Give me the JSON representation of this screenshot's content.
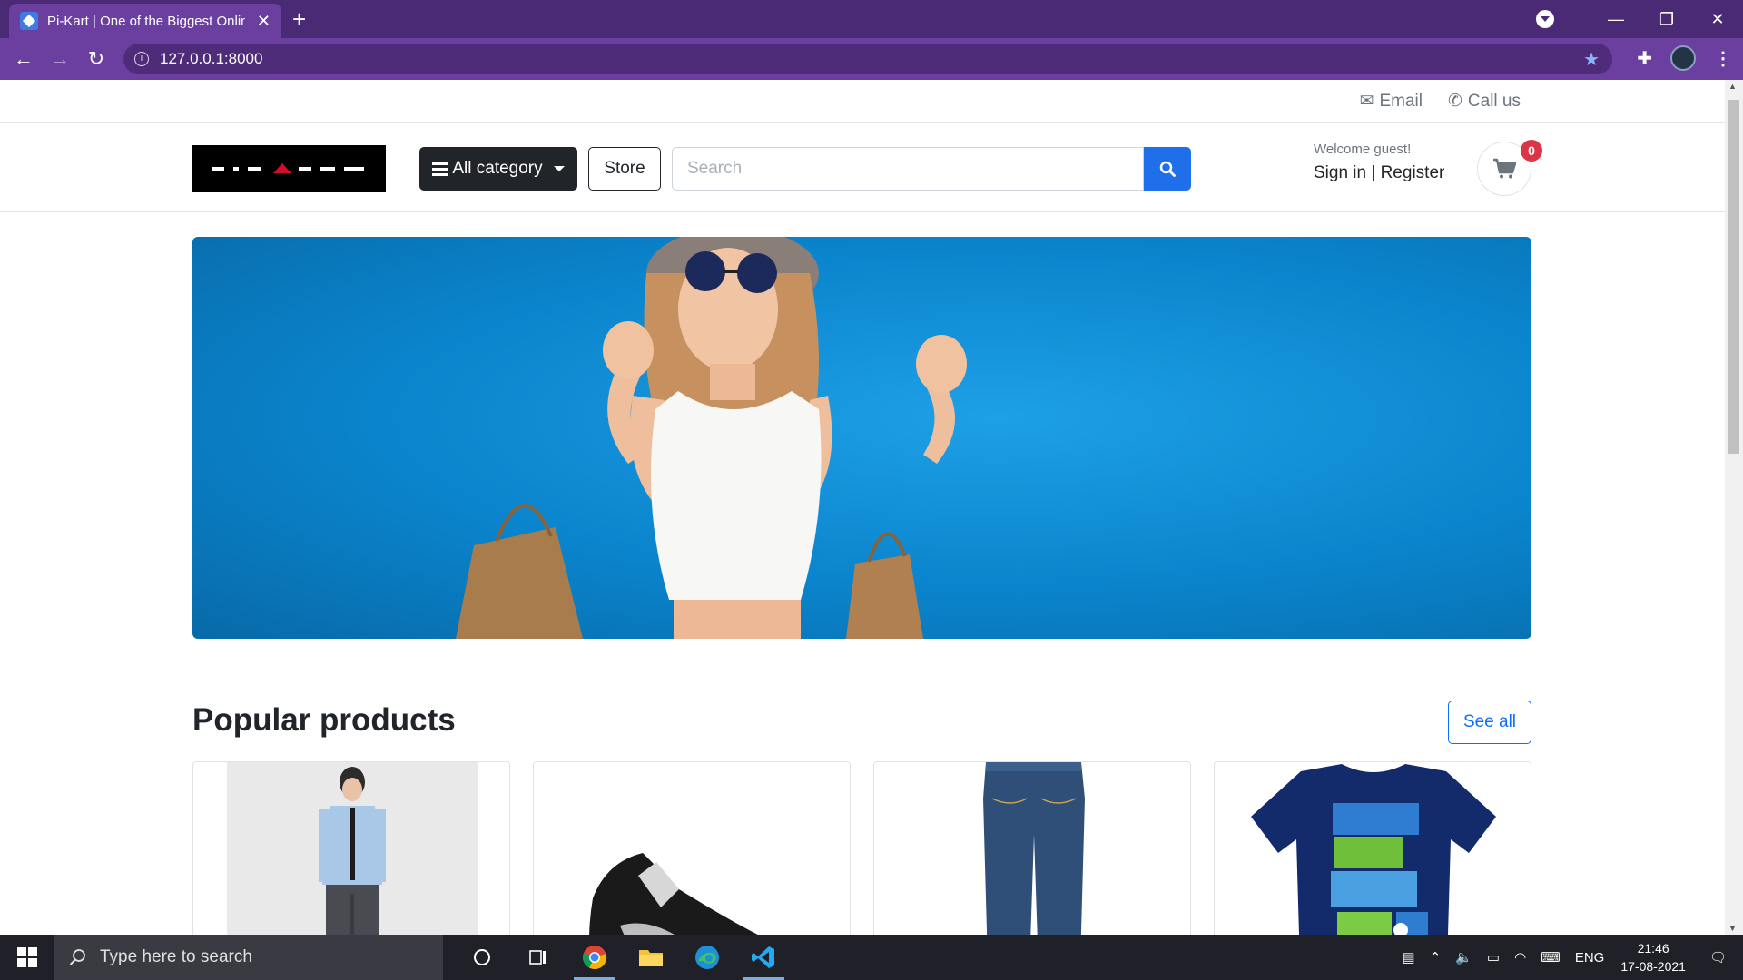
{
  "browser": {
    "tab_title": "Pi-Kart | One of the Biggest Online Shopping Platform",
    "url": "127.0.0.1:8000"
  },
  "topbar": {
    "email_label": "Email",
    "call_label": "Call us"
  },
  "header": {
    "logo_text": "PIKART",
    "all_category_label": "All category",
    "store_label": "Store",
    "search_placeholder": "Search",
    "welcome_text": "Welcome guest!",
    "signin_text": "Sign in | Register",
    "cart_count": "0"
  },
  "section": {
    "title": "Popular products",
    "see_all_label": "See all"
  },
  "products": [
    {
      "kind": "shirt-model"
    },
    {
      "kind": "sneaker"
    },
    {
      "kind": "jeans"
    },
    {
      "kind": "tshirt"
    }
  ],
  "taskbar": {
    "search_placeholder": "Type here to search",
    "language": "ENG",
    "time": "21:46",
    "date": "17-08-2021"
  },
  "colors": {
    "chrome_titlebar": "#4a2a74",
    "chrome_toolbar": "#6a3fa0",
    "accent": "#1f6feb",
    "badge": "#dc3545"
  }
}
